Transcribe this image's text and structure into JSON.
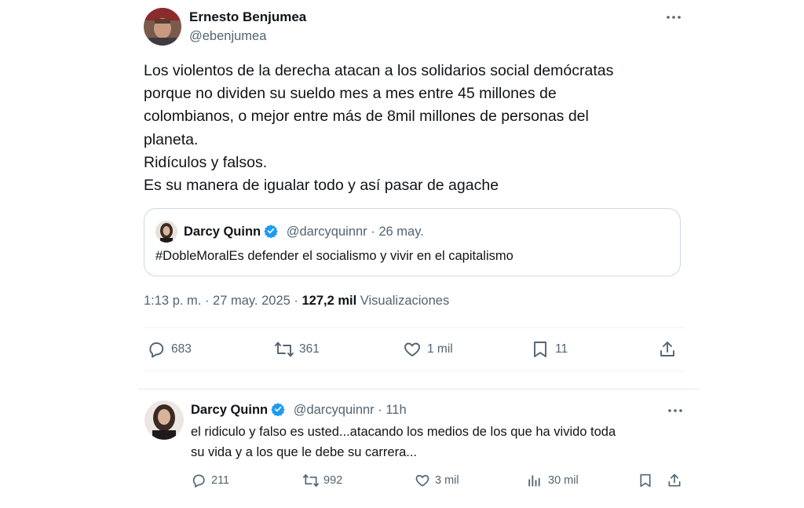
{
  "main_tweet": {
    "author_name": "Ernesto Benjumea",
    "author_handle": "@ebenjumea",
    "text_lines": [
      "Los violentos de la derecha atacan a los solidarios social demócratas",
      "porque no dividen su sueldo mes a mes entre 45 millones de",
      "colombianos, o mejor entre más de 8mil millones de personas del",
      "planeta.",
      "Ridículos y falsos.",
      "Es su manera de igualar todo y así pasar de agache"
    ],
    "quote": {
      "author_name": "Darcy Quinn",
      "author_handle": "@darcyquinnr",
      "separator": "·",
      "date": "26 may.",
      "text": "#DobleMoralEs defender el socialismo y vivir en el capitalismo"
    },
    "timestamp": "1:13 p. m. · 27 may. 2025 ·",
    "views_count": "127,2 mil",
    "views_label": "Visualizaciones",
    "actions": {
      "replies": "683",
      "retweets": "361",
      "likes": "1 mil",
      "bookmarks": "11"
    }
  },
  "reply_tweet": {
    "author_name": "Darcy Quinn",
    "author_handle": "@darcyquinnr",
    "separator": "·",
    "time": "11h",
    "text_lines": [
      "el ridiculo y falso es usted...atacando los medios de los que ha vivido toda",
      "su vida y a los que le debe su carrera..."
    ],
    "actions": {
      "replies": "211",
      "retweets": "992",
      "likes": "3 mil",
      "views": "30 mil"
    }
  },
  "colors": {
    "verified": "#1d9bf0",
    "muted_text": "#536471",
    "border": "#cfd9de"
  }
}
